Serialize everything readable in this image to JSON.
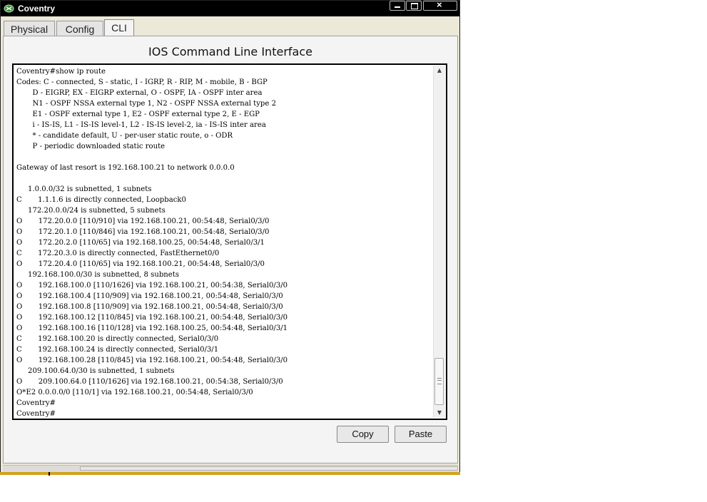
{
  "window": {
    "title": "Coventry",
    "app_icon": "device-icon",
    "controls": {
      "minimize": "minimize-icon",
      "maximize": "maximize-icon",
      "close": "×"
    }
  },
  "tabs": [
    {
      "label": "Physical",
      "active": false
    },
    {
      "label": "Config",
      "active": false
    },
    {
      "label": "CLI",
      "active": true
    }
  ],
  "cli": {
    "heading": "IOS Command Line Interface",
    "lines": [
      "Coventry#show ip route",
      "Codes: C - connected, S - static, I - IGRP, R - RIP, M - mobile, B - BGP",
      "       D - EIGRP, EX - EIGRP external, O - OSPF, IA - OSPF inter area",
      "       N1 - OSPF NSSA external type 1, N2 - OSPF NSSA external type 2",
      "       E1 - OSPF external type 1, E2 - OSPF external type 2, E - EGP",
      "       i - IS-IS, L1 - IS-IS level-1, L2 - IS-IS level-2, ia - IS-IS inter area",
      "       * - candidate default, U - per-user static route, o - ODR",
      "       P - periodic downloaded static route",
      "",
      "Gateway of last resort is 192.168.100.21 to network 0.0.0.0",
      "",
      "     1.0.0.0/32 is subnetted, 1 subnets",
      "C       1.1.1.6 is directly connected, Loopback0",
      "     172.20.0.0/24 is subnetted, 5 subnets",
      "O       172.20.0.0 [110/910] via 192.168.100.21, 00:54:48, Serial0/3/0",
      "O       172.20.1.0 [110/846] via 192.168.100.21, 00:54:48, Serial0/3/0",
      "O       172.20.2.0 [110/65] via 192.168.100.25, 00:54:48, Serial0/3/1",
      "C       172.20.3.0 is directly connected, FastEthernet0/0",
      "O       172.20.4.0 [110/65] via 192.168.100.21, 00:54:48, Serial0/3/0",
      "     192.168.100.0/30 is subnetted, 8 subnets",
      "O       192.168.100.0 [110/1626] via 192.168.100.21, 00:54:38, Serial0/3/0",
      "O       192.168.100.4 [110/909] via 192.168.100.21, 00:54:48, Serial0/3/0",
      "O       192.168.100.8 [110/909] via 192.168.100.21, 00:54:48, Serial0/3/0",
      "O       192.168.100.12 [110/845] via 192.168.100.21, 00:54:48, Serial0/3/0",
      "O       192.168.100.16 [110/128] via 192.168.100.25, 00:54:48, Serial0/3/1",
      "C       192.168.100.20 is directly connected, Serial0/3/0",
      "C       192.168.100.24 is directly connected, Serial0/3/1",
      "O       192.168.100.28 [110/845] via 192.168.100.21, 00:54:48, Serial0/3/0",
      "     209.100.64.0/30 is subnetted, 1 subnets",
      "O       209.100.64.0 [110/1626] via 192.168.100.21, 00:54:38, Serial0/3/0",
      "O*E2 0.0.0.0/0 [110/1] via 192.168.100.21, 00:54:48, Serial0/3/0",
      "Coventry#",
      "Coventry#"
    ]
  },
  "buttons": {
    "copy": "Copy",
    "paste": "Paste"
  },
  "icons": {
    "scroll_up": "▲",
    "scroll_down": "▼"
  },
  "colors": {
    "titlebar": "#000000",
    "window_bg": "#ece9d8",
    "accent_strip": "#d4a11a"
  }
}
